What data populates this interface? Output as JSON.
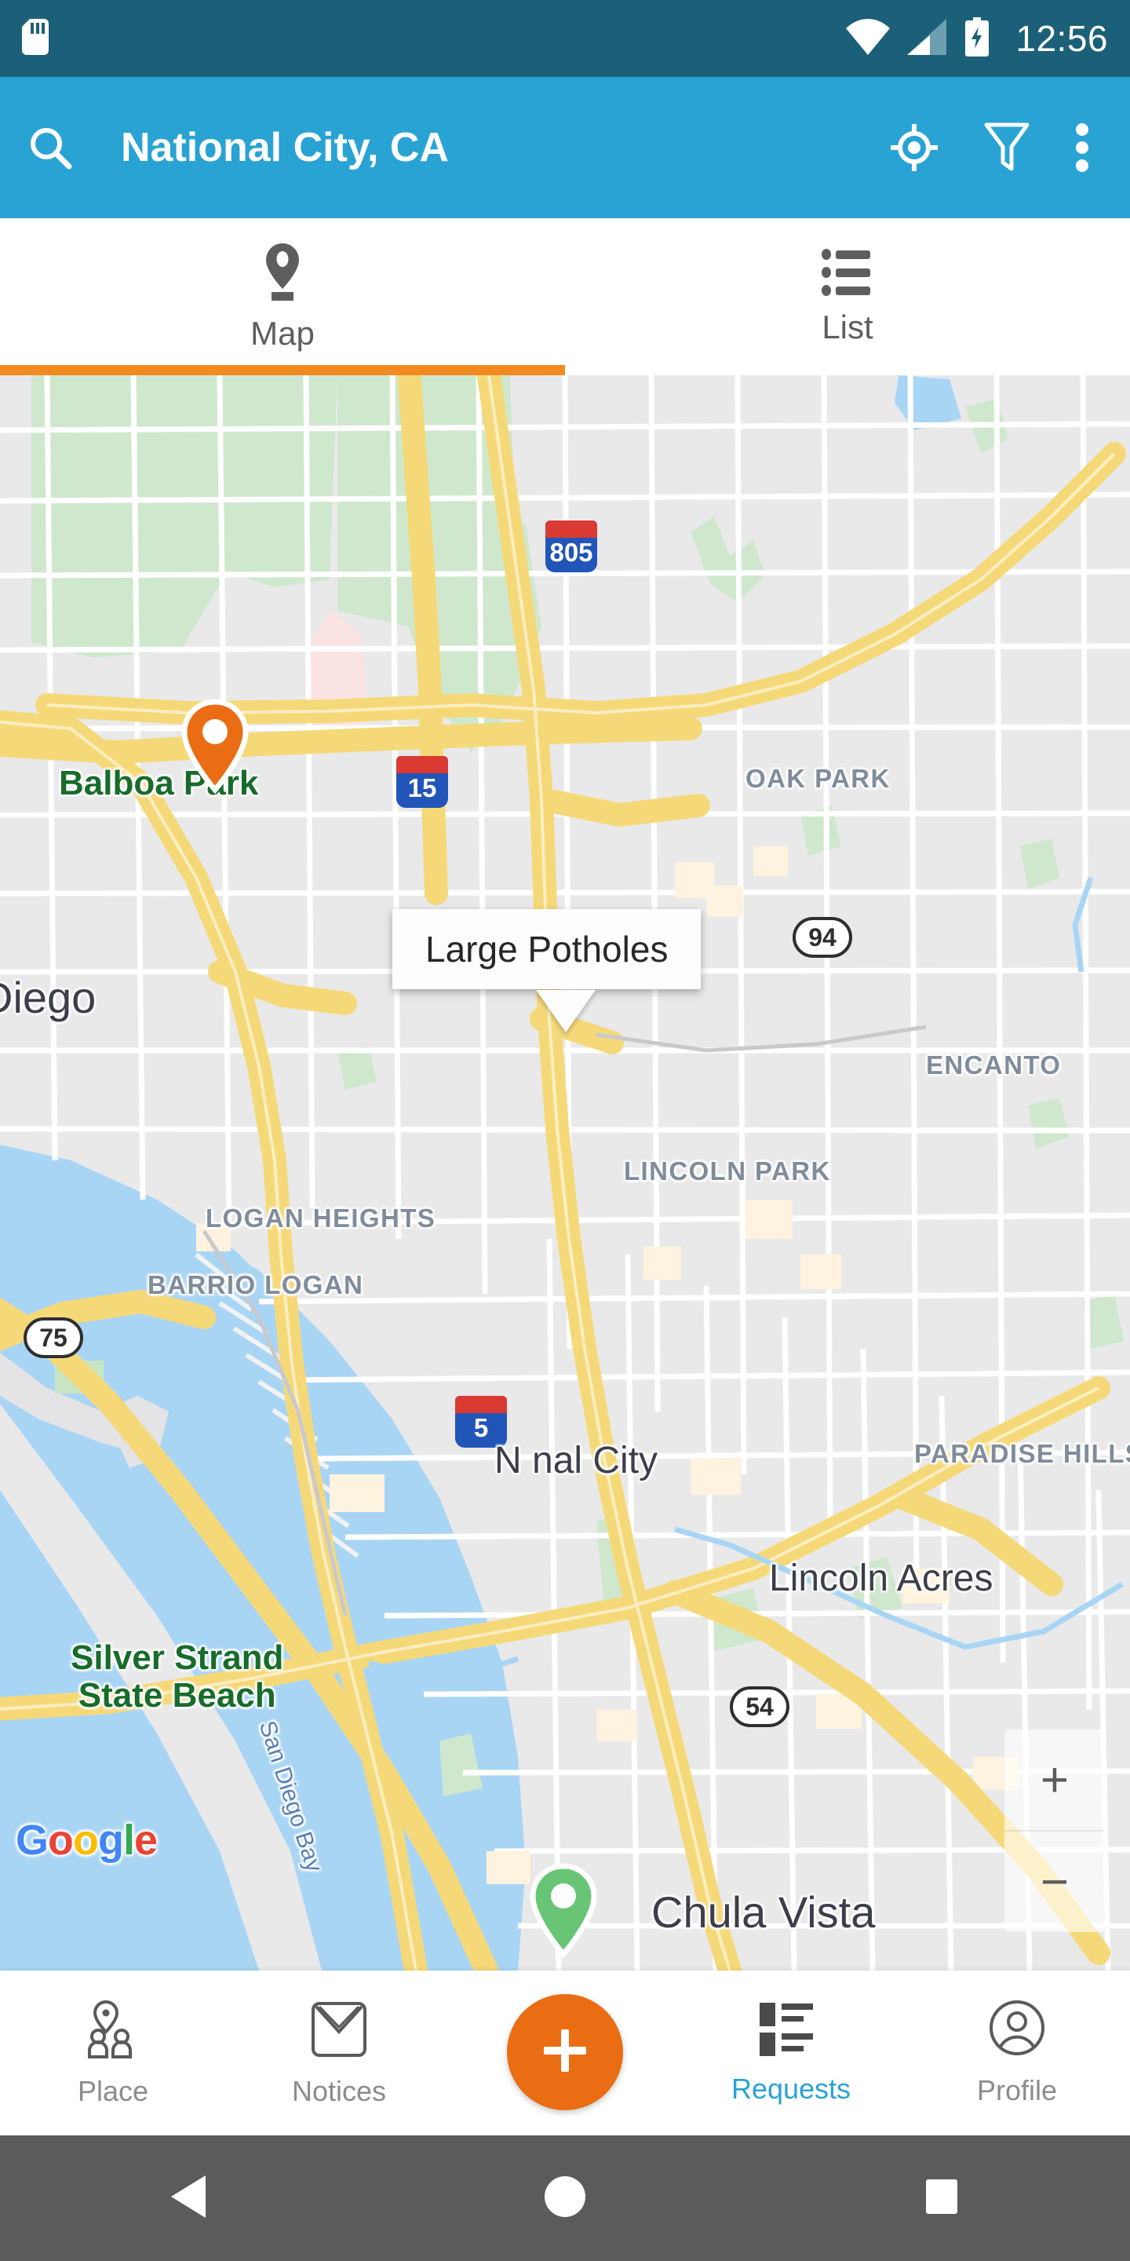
{
  "status_bar": {
    "time": "12:56",
    "icons": [
      "sd-card-icon",
      "wifi-icon",
      "cellular-signal-icon",
      "battery-charging-icon"
    ],
    "background_color": "#1b6078"
  },
  "app_bar": {
    "title": "National City, CA",
    "background_color": "#29a3d4",
    "search_icon": "search-icon",
    "my_location_icon": "my-location-icon",
    "filter_icon": "filter-icon",
    "overflow_icon": "more-vertical-icon"
  },
  "tabs": {
    "active_index": 0,
    "indicator_color": "#f28a20",
    "items": [
      {
        "label": "Map",
        "icon": "map-pin-icon"
      },
      {
        "label": "List",
        "icon": "list-icon"
      }
    ]
  },
  "map": {
    "attribution": "Google",
    "zoom_in_label": "+",
    "zoom_out_label": "−",
    "callout": {
      "title": "Large Potholes"
    },
    "markers": [
      {
        "name": "marker-logan-heights",
        "color": "#ea6d13"
      },
      {
        "name": "marker-selected-national-city",
        "color": "#69c576"
      },
      {
        "name": "marker-chula-vista",
        "color": "#ea6d13"
      }
    ],
    "labels": {
      "cities": [
        "Diego",
        "National City",
        "Lincoln Acres",
        "Chula Vista"
      ],
      "neighborhoods": [
        "OAK PARK",
        "ENCANTO",
        "LINCOLN PARK",
        "LOGAN HEIGHTS",
        "BARRIO LOGAN",
        "PARADISE HILLS"
      ],
      "parks": [
        "Balboa Park"
      ],
      "beach": [
        "Silver Strand",
        "State Beach"
      ],
      "water": [
        "San Diego Bay"
      ],
      "highways": [
        "805",
        "15",
        "5",
        "94",
        "54",
        "75"
      ]
    },
    "text": {
      "balboa_park": "Balboa Park",
      "diego": "Diego",
      "oak_park": "OAK PARK",
      "encanto": "ENCANTO",
      "lincoln_park": "LINCOLN PARK",
      "logan_heights": "LOGAN HEIGHTS",
      "barrio_logan": "BARRIO LOGAN",
      "paradise_hills": "PARADISE HILLS",
      "national_city": "N      nal City",
      "lincoln_acres": "Lincoln Acres",
      "chula_vista": "Chula Vista",
      "san_diego_bay": "San Diego Bay",
      "silver_strand_l1": "Silver Strand",
      "silver_strand_l2": "State Beach",
      "hwy_805": "805",
      "hwy_15": "15",
      "hwy_5": "5",
      "hwy_94": "94",
      "hwy_54": "54",
      "hwy_75": "75"
    }
  },
  "bottom_nav": {
    "active_label": "Requests",
    "active_color": "#29a3d4",
    "fab": {
      "icon": "plus-icon",
      "color": "#ea6d13"
    },
    "items": [
      {
        "label": "Place",
        "icon": "place-people-icon"
      },
      {
        "label": "Notices",
        "icon": "envelope-icon"
      },
      {
        "label": "Requests",
        "icon": "requests-list-icon"
      },
      {
        "label": "Profile",
        "icon": "profile-icon"
      }
    ]
  },
  "android_nav": {
    "background_color": "#5b5b5b",
    "buttons": [
      {
        "name": "back-button",
        "icon": "triangle-back-icon"
      },
      {
        "name": "home-button",
        "icon": "circle-home-icon"
      },
      {
        "name": "recents-button",
        "icon": "square-recents-icon"
      }
    ]
  }
}
